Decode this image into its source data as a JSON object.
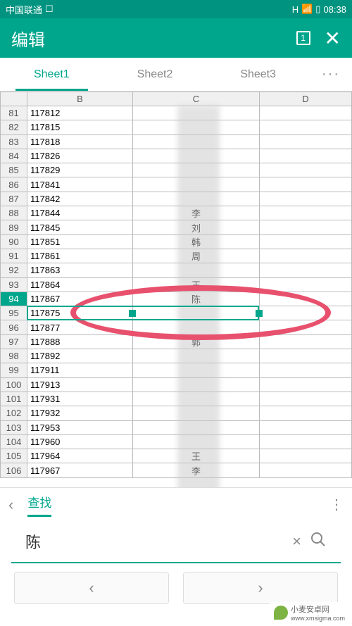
{
  "status": {
    "carrier": "中国联通",
    "netIcon": "H",
    "time": "08:38"
  },
  "header": {
    "title": "编辑",
    "badge": "1"
  },
  "tabs": {
    "sheet1": "Sheet1",
    "sheet2": "Sheet2",
    "sheet3": "Sheet3",
    "more": "···"
  },
  "columns": {
    "b": "B",
    "c": "C",
    "d": "D"
  },
  "rows": [
    {
      "r": "81",
      "b": "117812",
      "c": ""
    },
    {
      "r": "82",
      "b": "117815",
      "c": ""
    },
    {
      "r": "83",
      "b": "117818",
      "c": ""
    },
    {
      "r": "84",
      "b": "117826",
      "c": ""
    },
    {
      "r": "85",
      "b": "117829",
      "c": ""
    },
    {
      "r": "86",
      "b": "117841",
      "c": ""
    },
    {
      "r": "87",
      "b": "117842",
      "c": ""
    },
    {
      "r": "88",
      "b": "117844",
      "c": "李"
    },
    {
      "r": "89",
      "b": "117845",
      "c": "刘"
    },
    {
      "r": "90",
      "b": "117851",
      "c": "韩"
    },
    {
      "r": "91",
      "b": "117861",
      "c": "周"
    },
    {
      "r": "92",
      "b": "117863",
      "c": ""
    },
    {
      "r": "93",
      "b": "117864",
      "c": "王"
    },
    {
      "r": "94",
      "b": "117867",
      "c": "陈"
    },
    {
      "r": "95",
      "b": "117875",
      "c": ""
    },
    {
      "r": "96",
      "b": "117877",
      "c": ""
    },
    {
      "r": "97",
      "b": "117888",
      "c": "郭"
    },
    {
      "r": "98",
      "b": "117892",
      "c": ""
    },
    {
      "r": "99",
      "b": "117911",
      "c": ""
    },
    {
      "r": "100",
      "b": "117913",
      "c": ""
    },
    {
      "r": "101",
      "b": "117931",
      "c": ""
    },
    {
      "r": "102",
      "b": "117932",
      "c": ""
    },
    {
      "r": "103",
      "b": "117953",
      "c": ""
    },
    {
      "r": "104",
      "b": "117960",
      "c": ""
    },
    {
      "r": "105",
      "b": "117964",
      "c": "王"
    },
    {
      "r": "106",
      "b": "117967",
      "c": "李"
    }
  ],
  "selectedRow": "94",
  "find": {
    "label": "查找",
    "value": "陈",
    "back": "‹",
    "more": "⋮",
    "clear": "×",
    "search": "⌕",
    "prev": "‹",
    "next": "›"
  },
  "watermark": {
    "text": "小麦安卓网",
    "url": "www.xmsigma.com"
  }
}
